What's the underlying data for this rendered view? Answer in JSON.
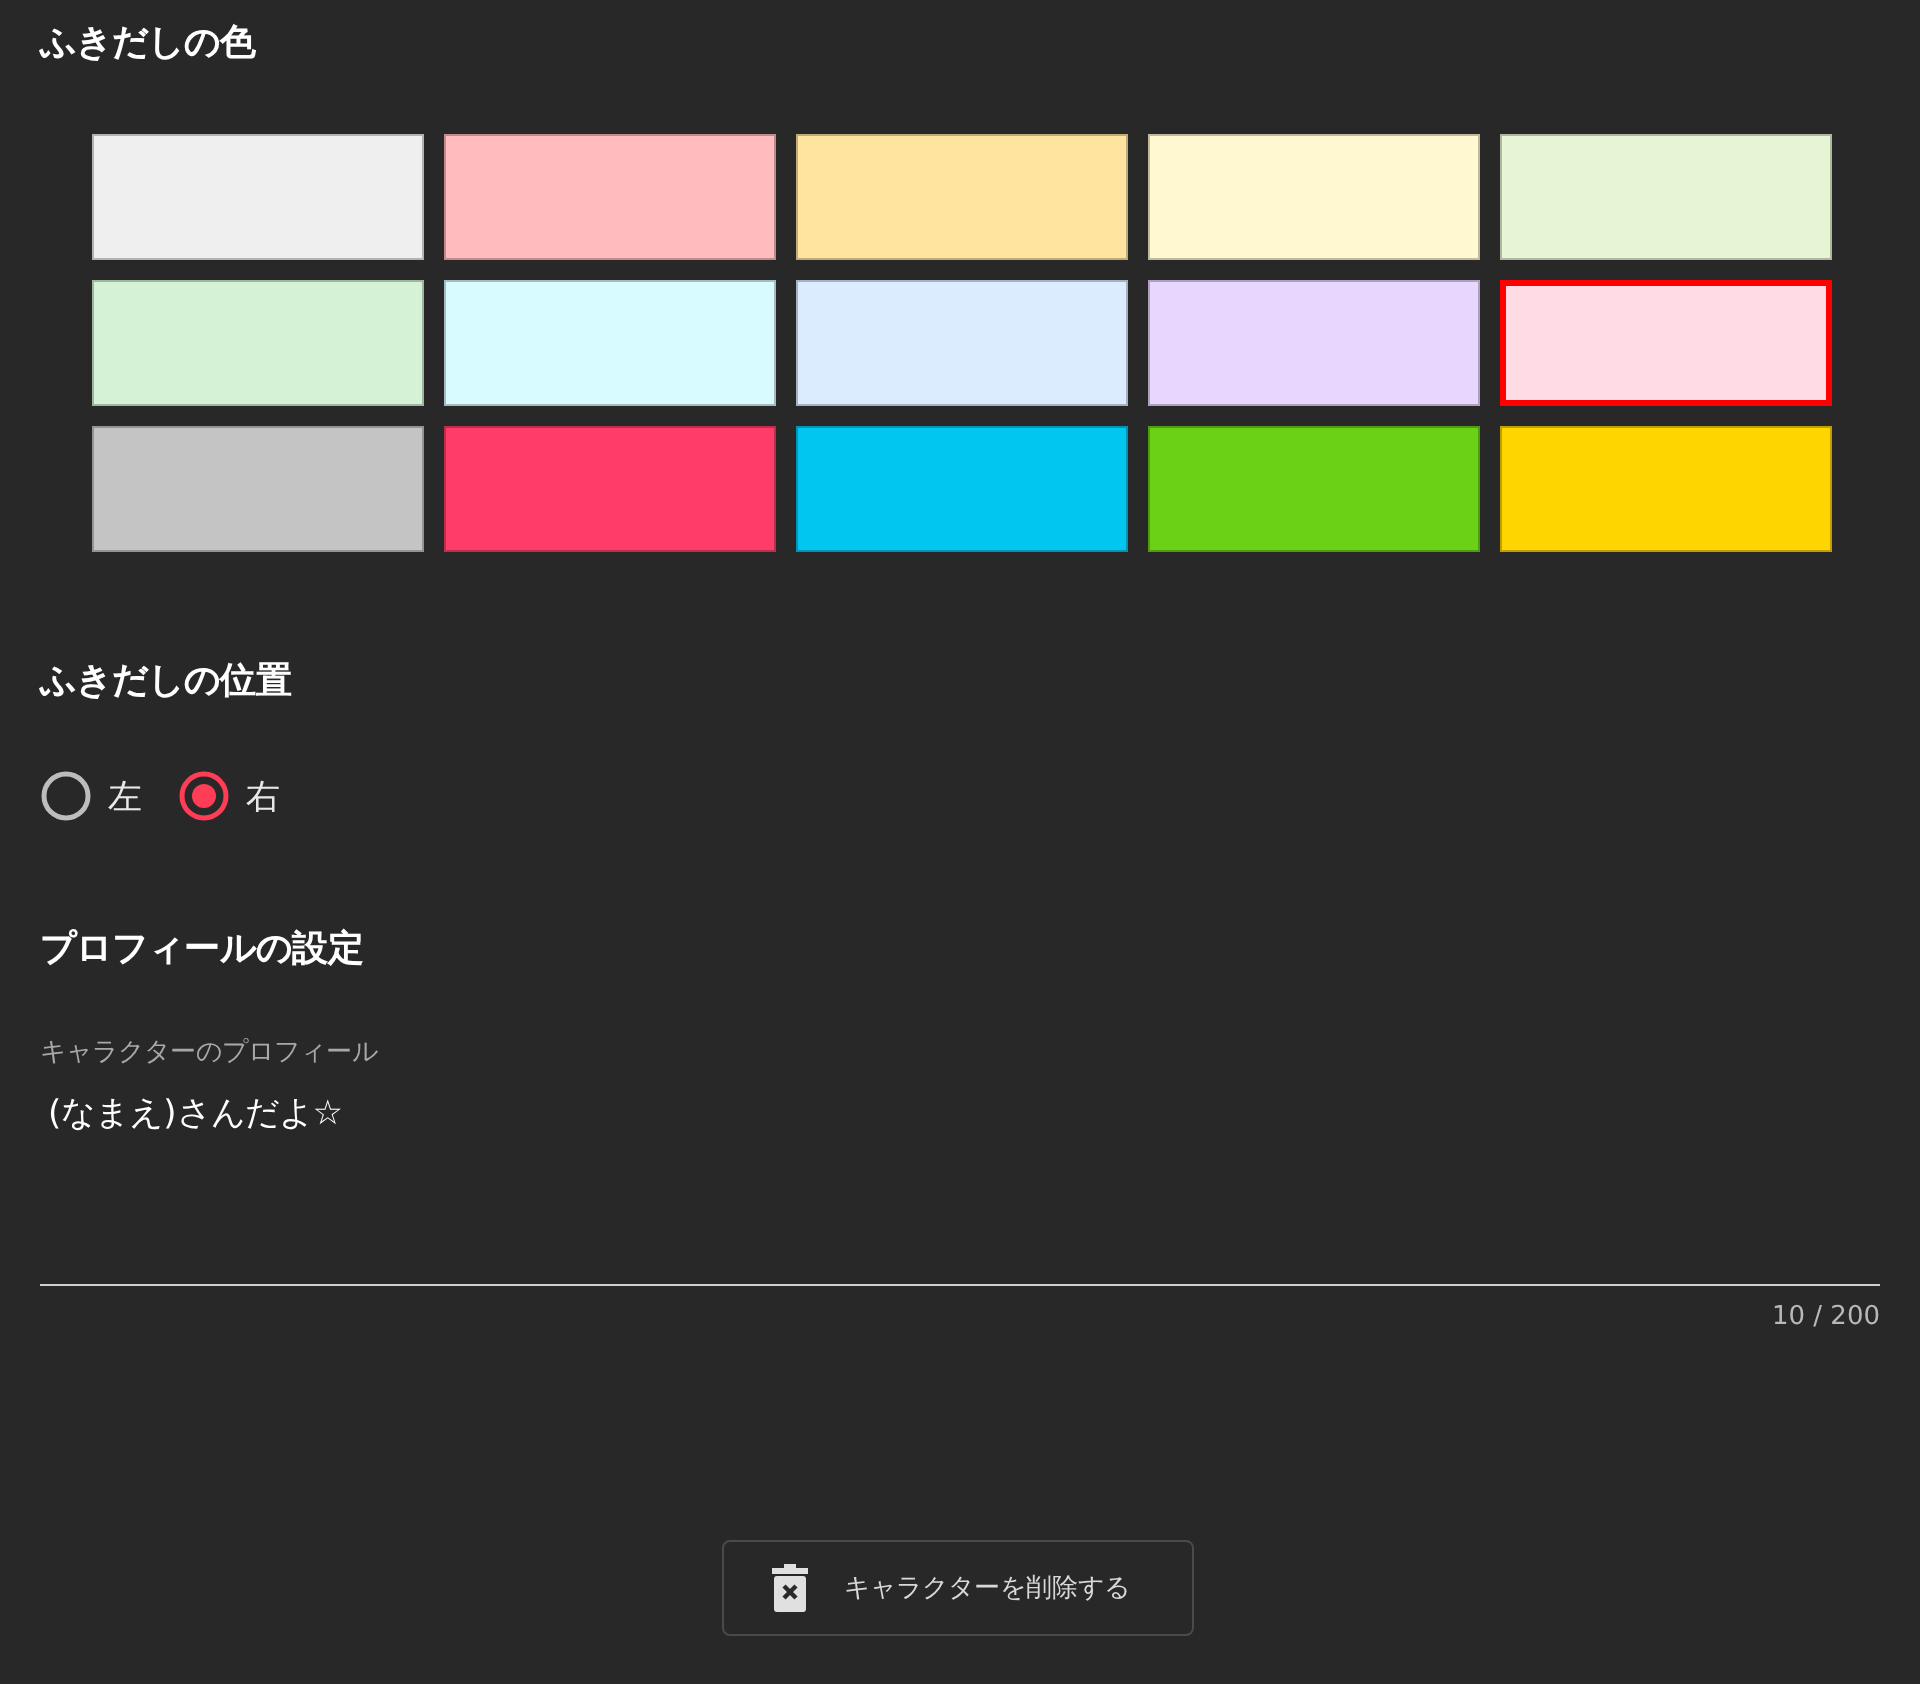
{
  "bubble_color": {
    "title": "ふきだしの色",
    "swatches": [
      {
        "color": "#efefef",
        "selected": false
      },
      {
        "color": "#ffbbbd",
        "selected": false
      },
      {
        "color": "#ffe4a0",
        "selected": false
      },
      {
        "color": "#fff8d0",
        "selected": false
      },
      {
        "color": "#e8f5d4",
        "selected": false
      },
      {
        "color": "#d6f2d6",
        "selected": false
      },
      {
        "color": "#d8fbff",
        "selected": false
      },
      {
        "color": "#dcecff",
        "selected": false
      },
      {
        "color": "#e8d6ff",
        "selected": false
      },
      {
        "color": "#ffdbe6",
        "selected": true
      },
      {
        "color": "#c4c4c4",
        "selected": false
      },
      {
        "color": "#ff3d68",
        "selected": false
      },
      {
        "color": "#00c6f0",
        "selected": false
      },
      {
        "color": "#6ad117",
        "selected": false
      },
      {
        "color": "#ffd500",
        "selected": false
      }
    ]
  },
  "bubble_position": {
    "title": "ふきだしの位置",
    "options": [
      {
        "label": "左",
        "selected": false
      },
      {
        "label": "右",
        "selected": true
      }
    ]
  },
  "profile": {
    "title": "プロフィールの設定",
    "field": {
      "label": "キャラクターのプロフィール",
      "value": "(なまえ)さんだよ☆",
      "counter": "10 / 200"
    }
  },
  "delete_button": {
    "label": "キャラクターを削除する"
  }
}
